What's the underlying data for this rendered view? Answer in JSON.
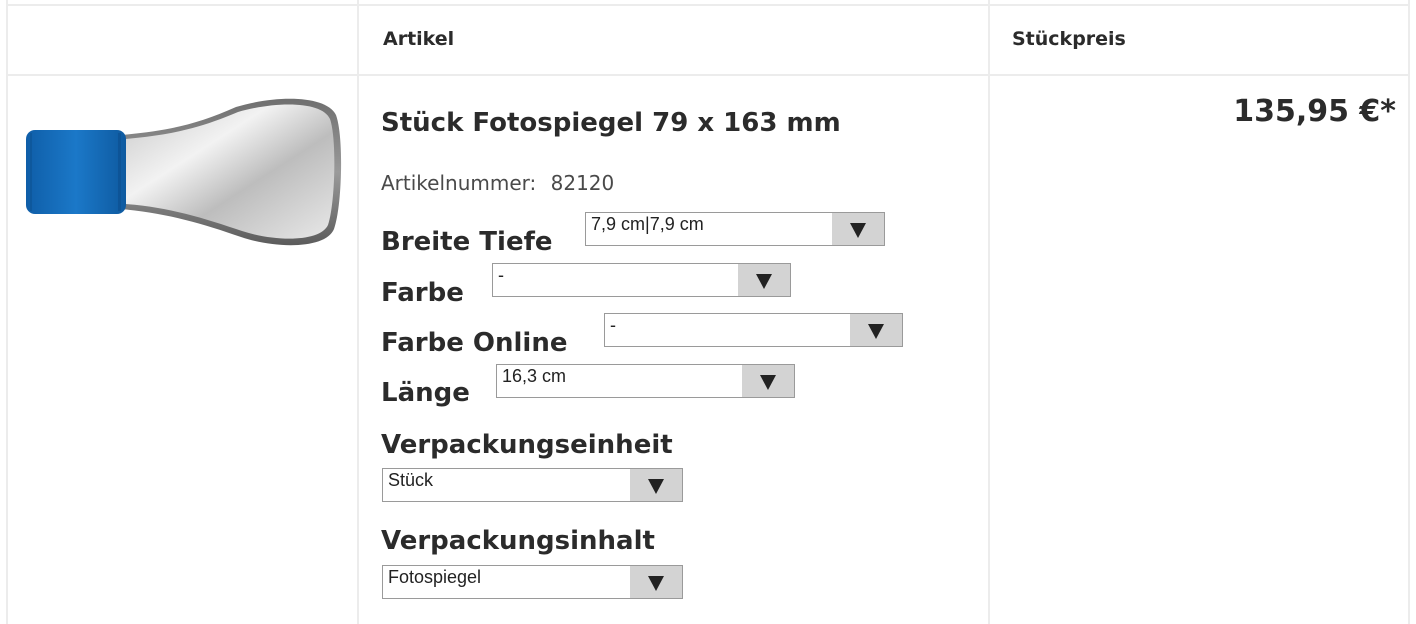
{
  "table": {
    "headers": {
      "article": "Artikel",
      "unit_price": "Stückpreis"
    }
  },
  "product": {
    "image_icon": "product-photo-mirror",
    "title": "Stück Fotospiegel 79 x 163 mm",
    "article_number_label": "Artikelnummer:",
    "article_number": "82120",
    "price": "135,95 €*"
  },
  "options": {
    "breite_tiefe": {
      "label": "Breite Tiefe",
      "value": "7,9 cm|7,9 cm"
    },
    "farbe": {
      "label": "Farbe",
      "value": "-"
    },
    "farbe_online": {
      "label": "Farbe Online",
      "value": "-"
    },
    "laenge": {
      "label": "Länge",
      "value": "16,3 cm"
    },
    "verpackungseinheit": {
      "label": "Verpackungseinheit",
      "value": "Stück"
    },
    "verpackungsinhalt": {
      "label": "Verpackungsinhalt",
      "value": "Fotospiegel"
    }
  },
  "colors": {
    "handle_blue": "#1570c0",
    "select_arrow_bg": "#d3d3d3",
    "border": "#ececec"
  }
}
